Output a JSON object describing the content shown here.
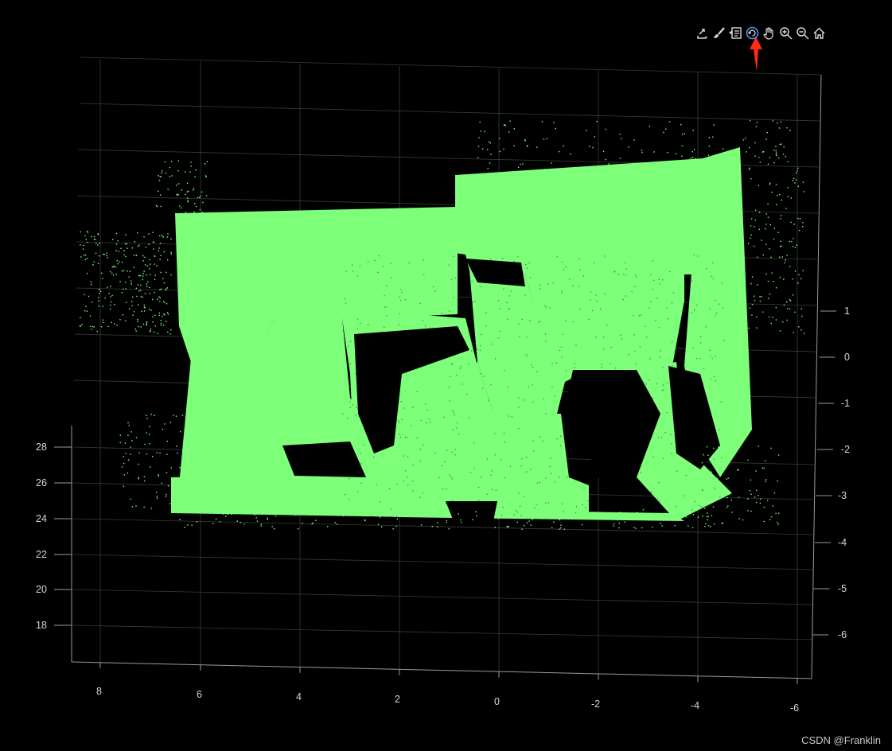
{
  "toolbar": {
    "tools": [
      {
        "name": "export-icon",
        "icon": "export"
      },
      {
        "name": "brush-icon",
        "icon": "brush"
      },
      {
        "name": "datatips-icon",
        "icon": "datatips"
      },
      {
        "name": "rotate-icon",
        "icon": "rotate",
        "active": true
      },
      {
        "name": "pan-icon",
        "icon": "pan"
      },
      {
        "name": "zoom-in-icon",
        "icon": "zoom-in"
      },
      {
        "name": "zoom-out-icon",
        "icon": "zoom-out"
      },
      {
        "name": "home-icon",
        "icon": "home"
      }
    ]
  },
  "annotation": {
    "color": "#ff2a1a"
  },
  "colors": {
    "points": "#7dff7a",
    "grid": "#3a3a3a",
    "axis": "#9a9a9a",
    "background": "#000000"
  },
  "axes": {
    "x_ticks": [
      "8",
      "6",
      "4",
      "2",
      "0",
      "-2",
      "-4",
      "-6"
    ],
    "y_ticks": [
      "28",
      "26",
      "24",
      "22",
      "20",
      "18"
    ],
    "z_ticks": [
      "1",
      "0",
      "-1",
      "-2",
      "-3",
      "-4",
      "-5",
      "-6"
    ]
  },
  "watermark": "CSDN @Franklin"
}
